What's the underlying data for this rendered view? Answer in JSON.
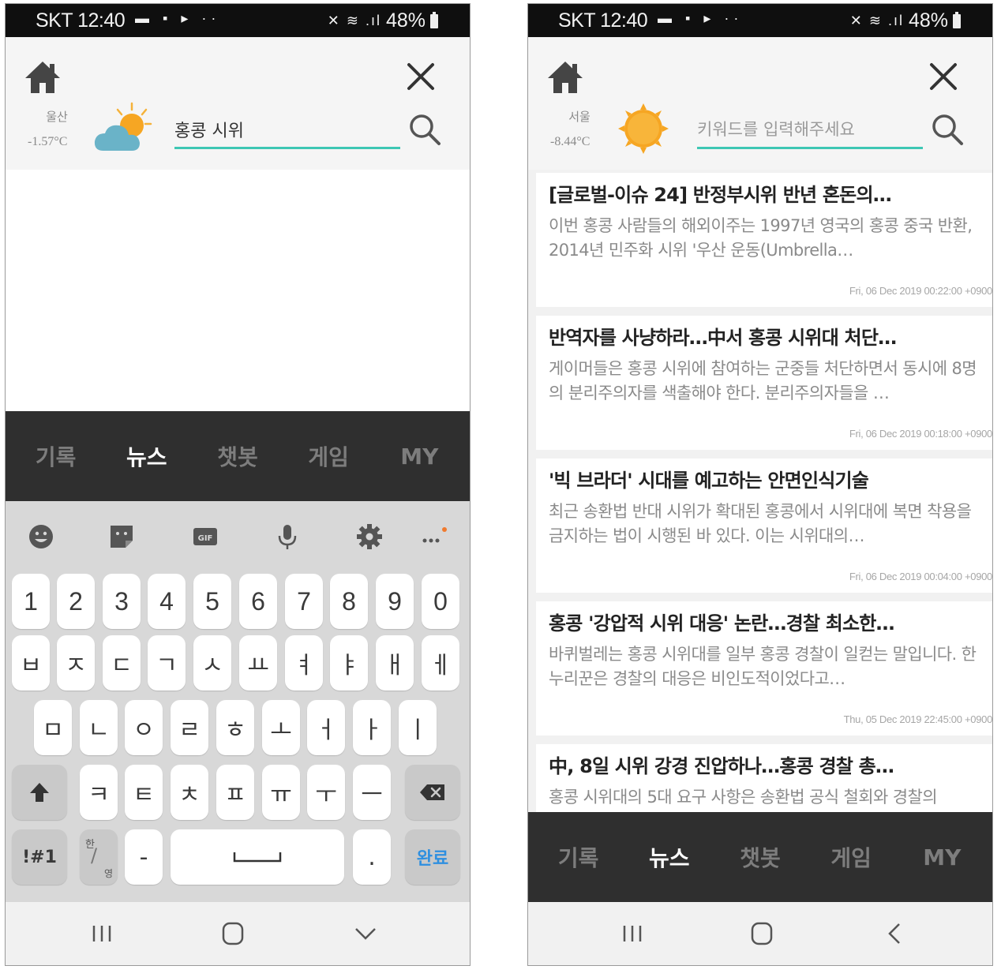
{
  "left": {
    "status": {
      "carrier_time": "SKT 12:40",
      "notif_icons": "▬ ▪ ▸ ··",
      "signal_icons": "✕ ≋ .ıl",
      "battery": "48%"
    },
    "header": {
      "city": "울산",
      "temperature": "-1.57°C",
      "search_value": "홍콩 시위"
    },
    "tabs": [
      "기록",
      "뉴스",
      "챗봇",
      "게임",
      "MY"
    ],
    "active_tab": "뉴스",
    "keyboard": {
      "row_numbers": [
        "1",
        "2",
        "3",
        "4",
        "5",
        "6",
        "7",
        "8",
        "9",
        "0"
      ],
      "row1": [
        "ㅂ",
        "ㅈ",
        "ㄷ",
        "ㄱ",
        "ㅅ",
        "ㅛ",
        "ㅕ",
        "ㅑ",
        "ㅐ",
        "ㅔ"
      ],
      "row2": [
        "ㅁ",
        "ㄴ",
        "ㅇ",
        "ㄹ",
        "ㅎ",
        "ㅗ",
        "ㅓ",
        "ㅏ",
        "ㅣ"
      ],
      "row3": [
        "ㅋ",
        "ㅌ",
        "ㅊ",
        "ㅍ",
        "ㅠ",
        "ㅜ",
        "ㅡ"
      ],
      "symbols_key": "!#1",
      "lang_key_top": "한",
      "lang_key_bottom": "영",
      "dash_key": "-",
      "period_key": ".",
      "done_key": "완료"
    }
  },
  "right": {
    "status": {
      "carrier_time": "SKT 12:40",
      "notif_icons": "▬ ▪ ▸ ··",
      "signal_icons": "✕ ≋ .ıl",
      "battery": "48%"
    },
    "header": {
      "city": "서울",
      "temperature": "-8.44°C",
      "search_placeholder": "키워드를 입력해주세요"
    },
    "tabs": [
      "기록",
      "뉴스",
      "챗봇",
      "게임",
      "MY"
    ],
    "active_tab": "뉴스",
    "news": [
      {
        "title": "[글로벌-이슈 24] 반정부시위 반년 혼돈의…",
        "summary": "이번 홍콩 사람들의 해외이주는 1997년 영국의 홍콩 중국 반환, 2014년 민주화 시위 '우산 운동(Umbrella…",
        "date": "Fri, 06 Dec 2019 00:22:00 +0900"
      },
      {
        "title": "반역자를 사냥하라…中서 홍콩 시위대 처단…",
        "summary": "게이머들은 홍콩 시위에 참여하는 군중들 처단하면서 동시에 8명의 분리주의자를 색출해야 한다. 분리주의자들을 …",
        "date": "Fri, 06 Dec 2019 00:18:00 +0900"
      },
      {
        "title": "'빅 브라더' 시대를 예고하는 안면인식기술",
        "summary": "최근 송환법 반대 시위가 확대된 홍콩에서 시위대에 복면 착용을 금지하는 법이 시행된 바 있다. 이는 시위대의…",
        "date": "Fri, 06 Dec 2019 00:04:00 +0900"
      },
      {
        "title": "홍콩 '강압적 시위 대응' 논란…경찰 최소한…",
        "summary": "바퀴벌레는 홍콩 시위대를 일부 홍콩 경찰이 일컫는 말입니다. 한 누리꾼은 경찰의 대응은 비인도적이었다고…",
        "date": "Thu, 05 Dec 2019 22:45:00 +0900"
      },
      {
        "title": "中, 8일 시위 강경 진압하나…홍콩 경찰 총…",
        "summary": "홍콩 시위대의 5대 요구 사항은 송환법 공식 철회와 경찰의",
        "date": ""
      }
    ]
  },
  "colors": {
    "accent_teal": "#3ec7b4",
    "tabbar_bg": "#2f2f2f",
    "done_blue": "#2e8fe0"
  }
}
